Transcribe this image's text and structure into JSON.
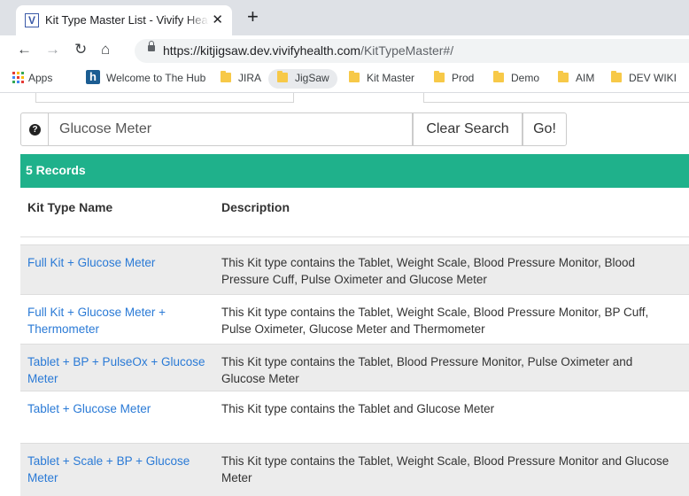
{
  "browser": {
    "tab_title": "Kit Type Master List - Vivify Healt",
    "tab_favicon_letter": "V",
    "url_host": "https://kitjigsaw.dev.vivifyhealth.com",
    "url_path": "/KitTypeMaster#/",
    "bookmarks": [
      {
        "label": "Apps",
        "icon": "apps-grid-icon"
      },
      {
        "label": "Welcome to The Hub",
        "icon": "hub-logo-icon"
      },
      {
        "label": "JIRA",
        "icon": "folder-icon"
      },
      {
        "label": "JigSaw",
        "icon": "folder-icon"
      },
      {
        "label": "Kit Master",
        "icon": "folder-icon"
      },
      {
        "label": "Prod",
        "icon": "folder-icon"
      },
      {
        "label": "Demo",
        "icon": "folder-icon"
      },
      {
        "label": "AIM",
        "icon": "folder-icon"
      },
      {
        "label": "DEV WIKI",
        "icon": "folder-icon"
      }
    ]
  },
  "search": {
    "value": "Glucose Meter",
    "clear_label": "Clear Search",
    "go_label": "Go!"
  },
  "records": {
    "label": "5 Records"
  },
  "table": {
    "headers": {
      "name": "Kit Type Name",
      "description": "Description"
    },
    "rows": [
      {
        "name": "Full Kit + Glucose Meter",
        "description": "This Kit type contains the Tablet, Weight Scale, Blood Pressure Monitor, Blood Pressure Cuff, Pulse Oximeter and Glucose Meter"
      },
      {
        "name": "Full Kit + Glucose Meter + Thermometer",
        "description": "This Kit type contains the Tablet, Weight Scale, Blood Pressure Monitor, BP Cuff, Pulse Oximeter, Glucose Meter and Thermometer"
      },
      {
        "name": "Tablet + BP + PulseOx + Glucose Meter",
        "description": "This Kit type contains the Tablet, Blood Pressure Monitor, Pulse Oximeter and Glucose Meter"
      },
      {
        "name": "Tablet + Glucose Meter",
        "description": "This Kit type contains the Tablet and Glucose Meter"
      },
      {
        "name": "Tablet + Scale + BP + Glucose Meter",
        "description": "This Kit type contains the Tablet, Weight Scale, Blood Pressure Monitor and Glucose Meter"
      }
    ]
  },
  "colors": {
    "accent": "#1fb18b",
    "link": "#2a7ad6",
    "stripe": "#ececec"
  }
}
